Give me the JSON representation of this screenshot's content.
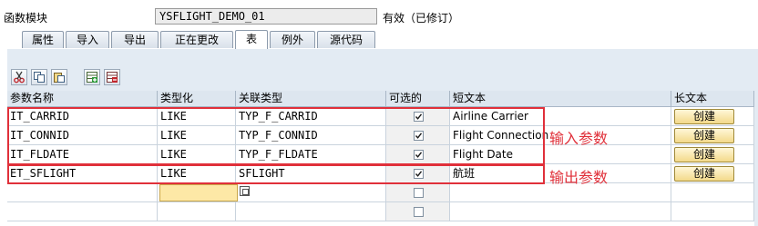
{
  "header": {
    "label": "函数模块",
    "function_name": "YSFLIGHT_DEMO_01",
    "status": "有效（已修订）"
  },
  "tabs": [
    {
      "label": "属性"
    },
    {
      "label": "导入"
    },
    {
      "label": "导出"
    },
    {
      "label": "正在更改"
    },
    {
      "label": "表"
    },
    {
      "label": "例外"
    },
    {
      "label": "源代码"
    }
  ],
  "active_tab": "表",
  "toolbar": [
    "cut-icon",
    "copy-icon",
    "paste-icon",
    "insert-row-icon",
    "delete-row-icon"
  ],
  "table": {
    "columns": [
      "参数名称",
      "类型化",
      "关联类型",
      "可选的",
      "短文本",
      "长文本"
    ],
    "rows": [
      {
        "name": "IT_CARRID",
        "typing": "LIKE",
        "ref_type": "TYP_F_CARRID",
        "optional": true,
        "short_text": "Airline Carrier",
        "long_text": "创建"
      },
      {
        "name": "IT_CONNID",
        "typing": "LIKE",
        "ref_type": "TYP_F_CONNID",
        "optional": true,
        "short_text": "Flight Connection",
        "long_text": "创建"
      },
      {
        "name": "IT_FLDATE",
        "typing": "LIKE",
        "ref_type": "TYP_F_FLDATE",
        "optional": true,
        "short_text": "Flight Date",
        "long_text": "创建"
      },
      {
        "name": "ET_SFLIGHT",
        "typing": "LIKE",
        "ref_type": "SFLIGHT",
        "optional": true,
        "short_text": "航班",
        "long_text": "创建"
      },
      {
        "name": "",
        "typing": "",
        "ref_type": "",
        "optional": false,
        "short_text": "",
        "long_text": ""
      },
      {
        "name": "",
        "typing": "",
        "ref_type": "",
        "optional": false,
        "short_text": "",
        "long_text": ""
      }
    ]
  },
  "annotations": {
    "input_params": "输入参数",
    "output_params": "输出参数",
    "color": "#e0303a"
  }
}
